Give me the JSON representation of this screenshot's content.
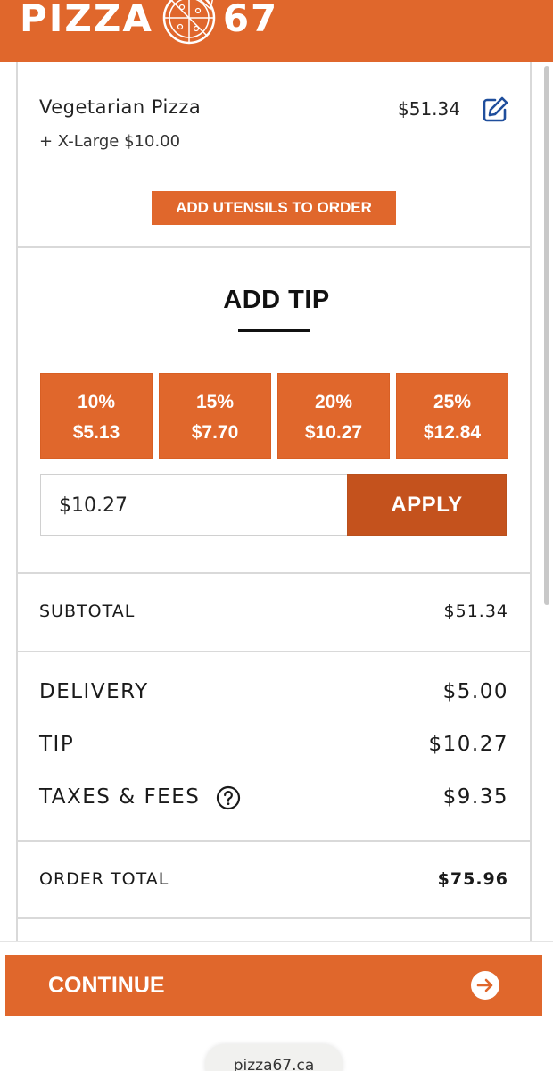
{
  "header": {
    "brand_left": "PIZZA",
    "brand_right": "67",
    "logo_icon": "pizza-icon",
    "background_color": "#e0672c"
  },
  "cart_item": {
    "name": "Vegetarian Pizza",
    "modifier": "+ X-Large $10.00",
    "price": "$51.34",
    "edit_icon": "edit-icon"
  },
  "utensils_button": "ADD UTENSILS TO ORDER",
  "tip": {
    "title": "ADD TIP",
    "options": [
      {
        "percent": "10%",
        "amount": "$5.13"
      },
      {
        "percent": "15%",
        "amount": "$7.70"
      },
      {
        "percent": "20%",
        "amount": "$10.27"
      },
      {
        "percent": "25%",
        "amount": "$12.84"
      }
    ],
    "custom_value": "$10.27",
    "apply_label": "APPLY"
  },
  "summary": {
    "subtotal_label": "SUBTOTAL",
    "subtotal_value": "$51.34",
    "delivery_label": "DELIVERY",
    "delivery_value": "$5.00",
    "tip_label": "TIP",
    "tip_value": "$10.27",
    "taxes_label": "TAXES & FEES",
    "taxes_value": "$9.35",
    "taxes_help_icon": "help-icon",
    "total_label": "ORDER TOTAL",
    "total_value": "$75.96"
  },
  "continue_button": {
    "label": "CONTINUE",
    "icon": "arrow-right-icon"
  },
  "browser": {
    "url": "pizza67.ca"
  }
}
